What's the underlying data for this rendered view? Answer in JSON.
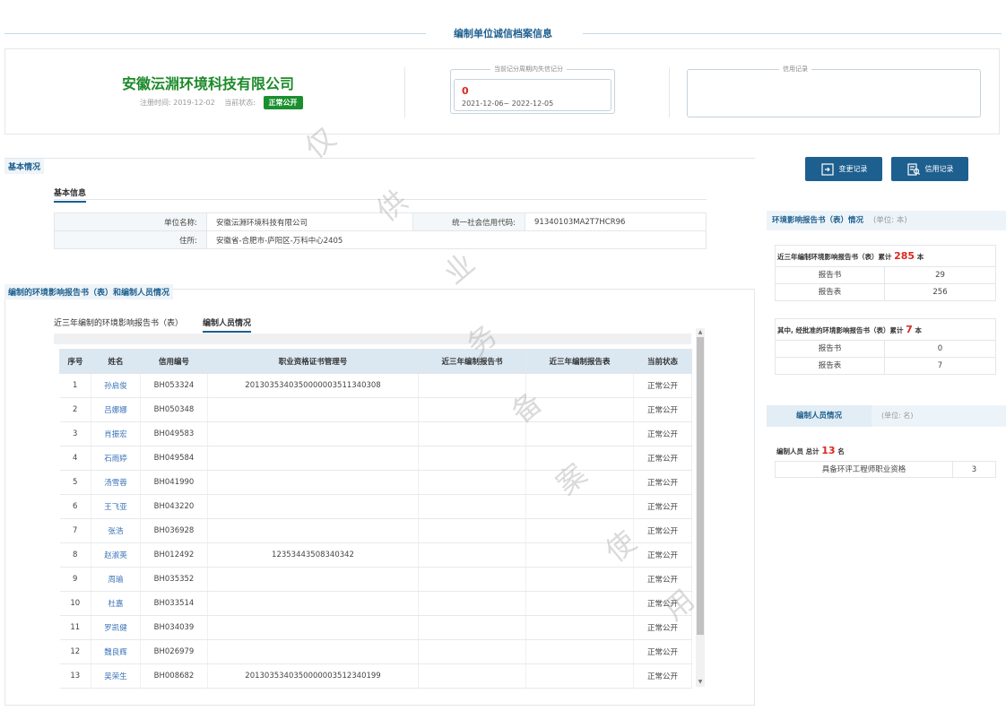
{
  "page": {
    "title": "编制单位诚信档案信息"
  },
  "company": {
    "name": "安徽沄淵环境科技有限公司",
    "reg_label": "注册时间: 2019-12-02",
    "status_label": "当前状态:",
    "status_badge": "正常公开"
  },
  "score_panel": {
    "legend": "当前记分周期内失信记分",
    "value": "0",
    "period": "2021-12-06~ 2022-12-05"
  },
  "credit_panel": {
    "legend": "信用记录"
  },
  "basic": {
    "section_title": "基本情况",
    "tab": "基本信息",
    "unit_name_label": "单位名称:",
    "unit_name": "安徽沄淵环境科技有限公司",
    "credit_code_label": "统一社会信用代码:",
    "credit_code": "91340103MA2T7HCR96",
    "address_label": "住所:",
    "address": "安徽省-合肥市-庐阳区-万科中心2405"
  },
  "staff": {
    "section_title": "编制的环境影响报告书（表）和编制人员情况",
    "tabs": [
      "近三年编制的环境影响报告书（表）",
      "编制人员情况"
    ],
    "columns": [
      "序号",
      "姓名",
      "信用编号",
      "职业资格证书管理号",
      "近三年编制报告书",
      "近三年编制报告表",
      "当前状态"
    ],
    "rows": [
      [
        "1",
        "孙启俊",
        "BH053324",
        "2013035340350000003511340308",
        "",
        "",
        "正常公开"
      ],
      [
        "2",
        "吕娜娜",
        "BH050348",
        "",
        "",
        "",
        "正常公开"
      ],
      [
        "3",
        "肖振宏",
        "BH049583",
        "",
        "",
        "",
        "正常公开"
      ],
      [
        "4",
        "石雨婷",
        "BH049584",
        "",
        "",
        "",
        "正常公开"
      ],
      [
        "5",
        "汤雪蓉",
        "BH041990",
        "",
        "",
        "",
        "正常公开"
      ],
      [
        "6",
        "王飞亚",
        "BH043220",
        "",
        "",
        "",
        "正常公开"
      ],
      [
        "7",
        "张浩",
        "BH036928",
        "",
        "",
        "",
        "正常公开"
      ],
      [
        "8",
        "赵淑英",
        "BH012492",
        "12353443508340342",
        "",
        "",
        "正常公开"
      ],
      [
        "9",
        "周瑜",
        "BH035352",
        "",
        "",
        "",
        "正常公开"
      ],
      [
        "10",
        "杜嘉",
        "BH033514",
        "",
        "",
        "",
        "正常公开"
      ],
      [
        "11",
        "罗凯健",
        "BH034039",
        "",
        "",
        "",
        "正常公开"
      ],
      [
        "12",
        "魏良辉",
        "BH026979",
        "",
        "",
        "",
        "正常公开"
      ],
      [
        "13",
        "吴荣生",
        "BH008682",
        "2013035340350000003512340199",
        "",
        "",
        "正常公开"
      ]
    ]
  },
  "buttons": {
    "change_record": "变更记录",
    "credit_record": "信用记录"
  },
  "report_panel": {
    "title": "环境影响报告书（表）情况",
    "unit": "(单位: 本)",
    "box1_title_prefix": "近三年编制环境影响报告书（表）累计",
    "box1_total": "285",
    "box1_suffix": "本",
    "box1_rows": [
      [
        "报告书",
        "29"
      ],
      [
        "报告表",
        "256"
      ]
    ],
    "box2_title_prefix": "其中, 经批准的环境影响报告书（表）累计",
    "box2_total": "7",
    "box2_suffix": "本",
    "box2_rows": [
      [
        "报告书",
        "0"
      ],
      [
        "报告表",
        "7"
      ]
    ]
  },
  "staff_panel": {
    "title": "编制人员情况",
    "unit": "(单位: 名)",
    "total_prefix": "编制人员 总计",
    "total": "13",
    "total_suffix": "名",
    "qual_label": "具备环评工程师职业资格",
    "qual_value": "3"
  },
  "watermark": [
    "仅",
    "供",
    "业",
    "务",
    "备",
    "案",
    "使",
    "用"
  ],
  "colors": {
    "accent": "#1d5f8f",
    "status_green": "#1a8f2e",
    "highlight_red": "#d9281f",
    "link_blue": "#3a73b8"
  }
}
